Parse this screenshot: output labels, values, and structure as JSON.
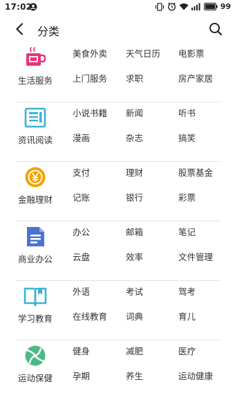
{
  "status_bar": {
    "time": "17:02",
    "battery": "99",
    "icons": [
      "notification-face-icon",
      "vibrate-icon",
      "alarm-icon",
      "wifi-icon",
      "signal-icon",
      "battery-icon"
    ]
  },
  "toolbar": {
    "back_icon": "back-arrow-icon",
    "title": "分类",
    "search_icon": "search-icon"
  },
  "colors": {
    "life": "#e8357a",
    "reading": "#39b3d5",
    "finance": "#f2a200",
    "business": "#4b74cf",
    "study": "#39b3d5",
    "sports": "#4cba87",
    "divider": "#e2e2e2",
    "text": "#333333"
  },
  "categories": [
    {
      "label": "生活服务",
      "icon": "cup-icon",
      "items": [
        "美食外卖",
        "天气日历",
        "电影票",
        "上门服务",
        "求职",
        "房产家居"
      ]
    },
    {
      "label": "资讯阅读",
      "icon": "newspaper-icon",
      "items": [
        "小说书籍",
        "新闻",
        "听书",
        "漫画",
        "杂志",
        "搞笑"
      ]
    },
    {
      "label": "金融理财",
      "icon": "yen-coin-icon",
      "items": [
        "支付",
        "理财",
        "股票基金",
        "记账",
        "银行",
        "彩票"
      ]
    },
    {
      "label": "商业办公",
      "icon": "document-icon",
      "items": [
        "办公",
        "邮箱",
        "笔记",
        "云盘",
        "效率",
        "文件管理"
      ]
    },
    {
      "label": "学习教育",
      "icon": "open-book-icon",
      "items": [
        "外语",
        "考试",
        "驾考",
        "在线教育",
        "词典",
        "育儿"
      ]
    },
    {
      "label": "运动保健",
      "icon": "ball-icon",
      "items": [
        "健身",
        "减肥",
        "医疗",
        "孕期",
        "养生",
        "运动健康"
      ]
    }
  ]
}
